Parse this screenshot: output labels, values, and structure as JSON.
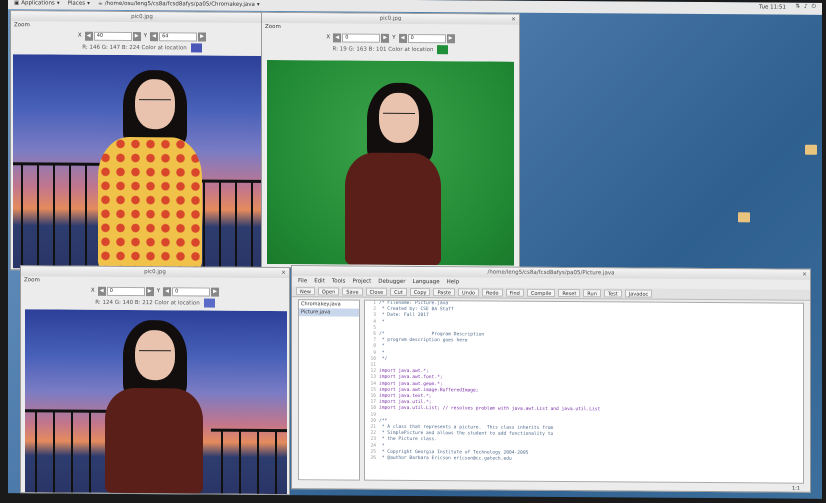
{
  "topbar": {
    "applications": "Applications",
    "places": "Places",
    "path": "/home/osu/leng5/cs8a/fcsd8afys/pa05/Chromakey.java",
    "clock": "Tue 11:51"
  },
  "windows": [
    {
      "title": "pic0.jpg",
      "zoom": "Zoom",
      "x_label": "X",
      "x_value": "40",
      "y_label": "Y",
      "y_value": "64",
      "rgb": "R: 146 G: 147 B: 224 Color at location",
      "swatch": "#4a56b8"
    },
    {
      "title": "pic0.jpg",
      "zoom": "Zoom",
      "x_label": "X",
      "x_value": "0",
      "y_label": "Y",
      "y_value": "0",
      "rgb": "R: 19 G: 163 B: 101 Color at location",
      "swatch": "#1f8f3a"
    },
    {
      "title": "pic0.jpg",
      "zoom": "Zoom",
      "x_label": "X",
      "x_value": "0",
      "y_label": "Y",
      "y_value": "0",
      "rgb": "R: 124 G: 140 B: 212 Color at location",
      "swatch": "#5a6cc8"
    }
  ],
  "editor": {
    "title": "/home/leng5/cs8a/fcsd8afys/pa05/Picture.java",
    "menu": [
      "File",
      "Edit",
      "Tools",
      "Project",
      "Debugger",
      "Language",
      "Help"
    ],
    "toolbar": [
      "New",
      "Open",
      "Save",
      "Close",
      "Cut",
      "Copy",
      "Paste",
      "Undo",
      "Redo",
      "Find",
      "Compile",
      "Reset",
      "Run",
      "Test",
      "Javadoc"
    ],
    "files": [
      "Chromakey.java",
      "Picture.java"
    ],
    "status": "1:1"
  },
  "code": [
    {
      "n": "1",
      "t": "/* Filename: Picture.java",
      "c": "cm"
    },
    {
      "n": "2",
      "t": " * Created by: CSE 8A Staff",
      "c": "cm"
    },
    {
      "n": "3",
      "t": " * Date: Fall 2017",
      "c": "cm"
    },
    {
      "n": "4",
      "t": " *",
      "c": "cm"
    },
    {
      "n": "5",
      "t": "",
      "c": "tx"
    },
    {
      "n": "6",
      "t": "/*                 Program Description",
      "c": "cm"
    },
    {
      "n": "7",
      "t": " * program description goes here",
      "c": "cm"
    },
    {
      "n": "8",
      "t": " *",
      "c": "cm"
    },
    {
      "n": "9",
      "t": " *",
      "c": "cm"
    },
    {
      "n": "10",
      "t": " */",
      "c": "cm"
    },
    {
      "n": "11",
      "t": "",
      "c": "tx"
    },
    {
      "n": "12",
      "t": "import java.awt.*;",
      "c": "kw"
    },
    {
      "n": "13",
      "t": "import java.awt.font.*;",
      "c": "kw"
    },
    {
      "n": "14",
      "t": "import java.awt.geom.*;",
      "c": "kw"
    },
    {
      "n": "15",
      "t": "import java.awt.image.BufferedImage;",
      "c": "kw"
    },
    {
      "n": "16",
      "t": "import java.text.*;",
      "c": "kw"
    },
    {
      "n": "17",
      "t": "import java.util.*;",
      "c": "kw"
    },
    {
      "n": "18",
      "t": "import java.util.List; // resolves problem with java.awt.List and java.util.List",
      "c": "kw"
    },
    {
      "n": "19",
      "t": "",
      "c": "tx"
    },
    {
      "n": "20",
      "t": "/**",
      "c": "cm"
    },
    {
      "n": "21",
      "t": " * A class that represents a picture.  This class inherits from",
      "c": "cm"
    },
    {
      "n": "22",
      "t": " * SimplePicture and allows the student to add functionality to",
      "c": "cm"
    },
    {
      "n": "23",
      "t": " * the Picture class.",
      "c": "cm"
    },
    {
      "n": "24",
      "t": " *",
      "c": "cm"
    },
    {
      "n": "25",
      "t": " * Copyright Georgia Institute of Technology 2004-2005",
      "c": "cm"
    },
    {
      "n": "26",
      "t": " * @author Barbara Ericson ericson@cc.gatech.edu",
      "c": "cm"
    }
  ]
}
